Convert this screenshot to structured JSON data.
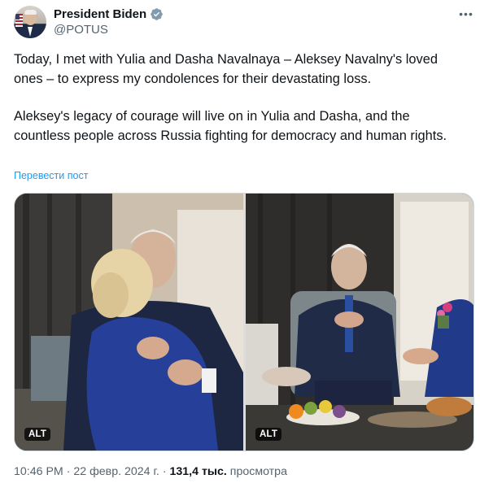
{
  "author": {
    "name": "President Biden",
    "handle": "@POTUS"
  },
  "tweet": {
    "paragraph1": "Today, I met with Yulia and Dasha Navalnaya – Aleksey Navalny's loved ones – to express my condolences for their devastating loss.",
    "paragraph2": "Aleksey's legacy of courage will live on in Yulia and Dasha, and the countless people across Russia fighting for democracy and human rights.",
    "translate_label": "Перевести пост"
  },
  "media": {
    "alt_label_1": "ALT",
    "alt_label_2": "ALT"
  },
  "meta": {
    "time": "10:46 PM",
    "separator": "·",
    "date": "22 февр. 2024 г.",
    "views_count": "131,4 тыс.",
    "views_label": "просмотра"
  },
  "icons": {
    "verified": "verified-badge-icon",
    "more": "more-options-icon"
  },
  "colors": {
    "link": "#1d9bf0",
    "verified": "#829aab",
    "secondary_text": "#536471"
  }
}
